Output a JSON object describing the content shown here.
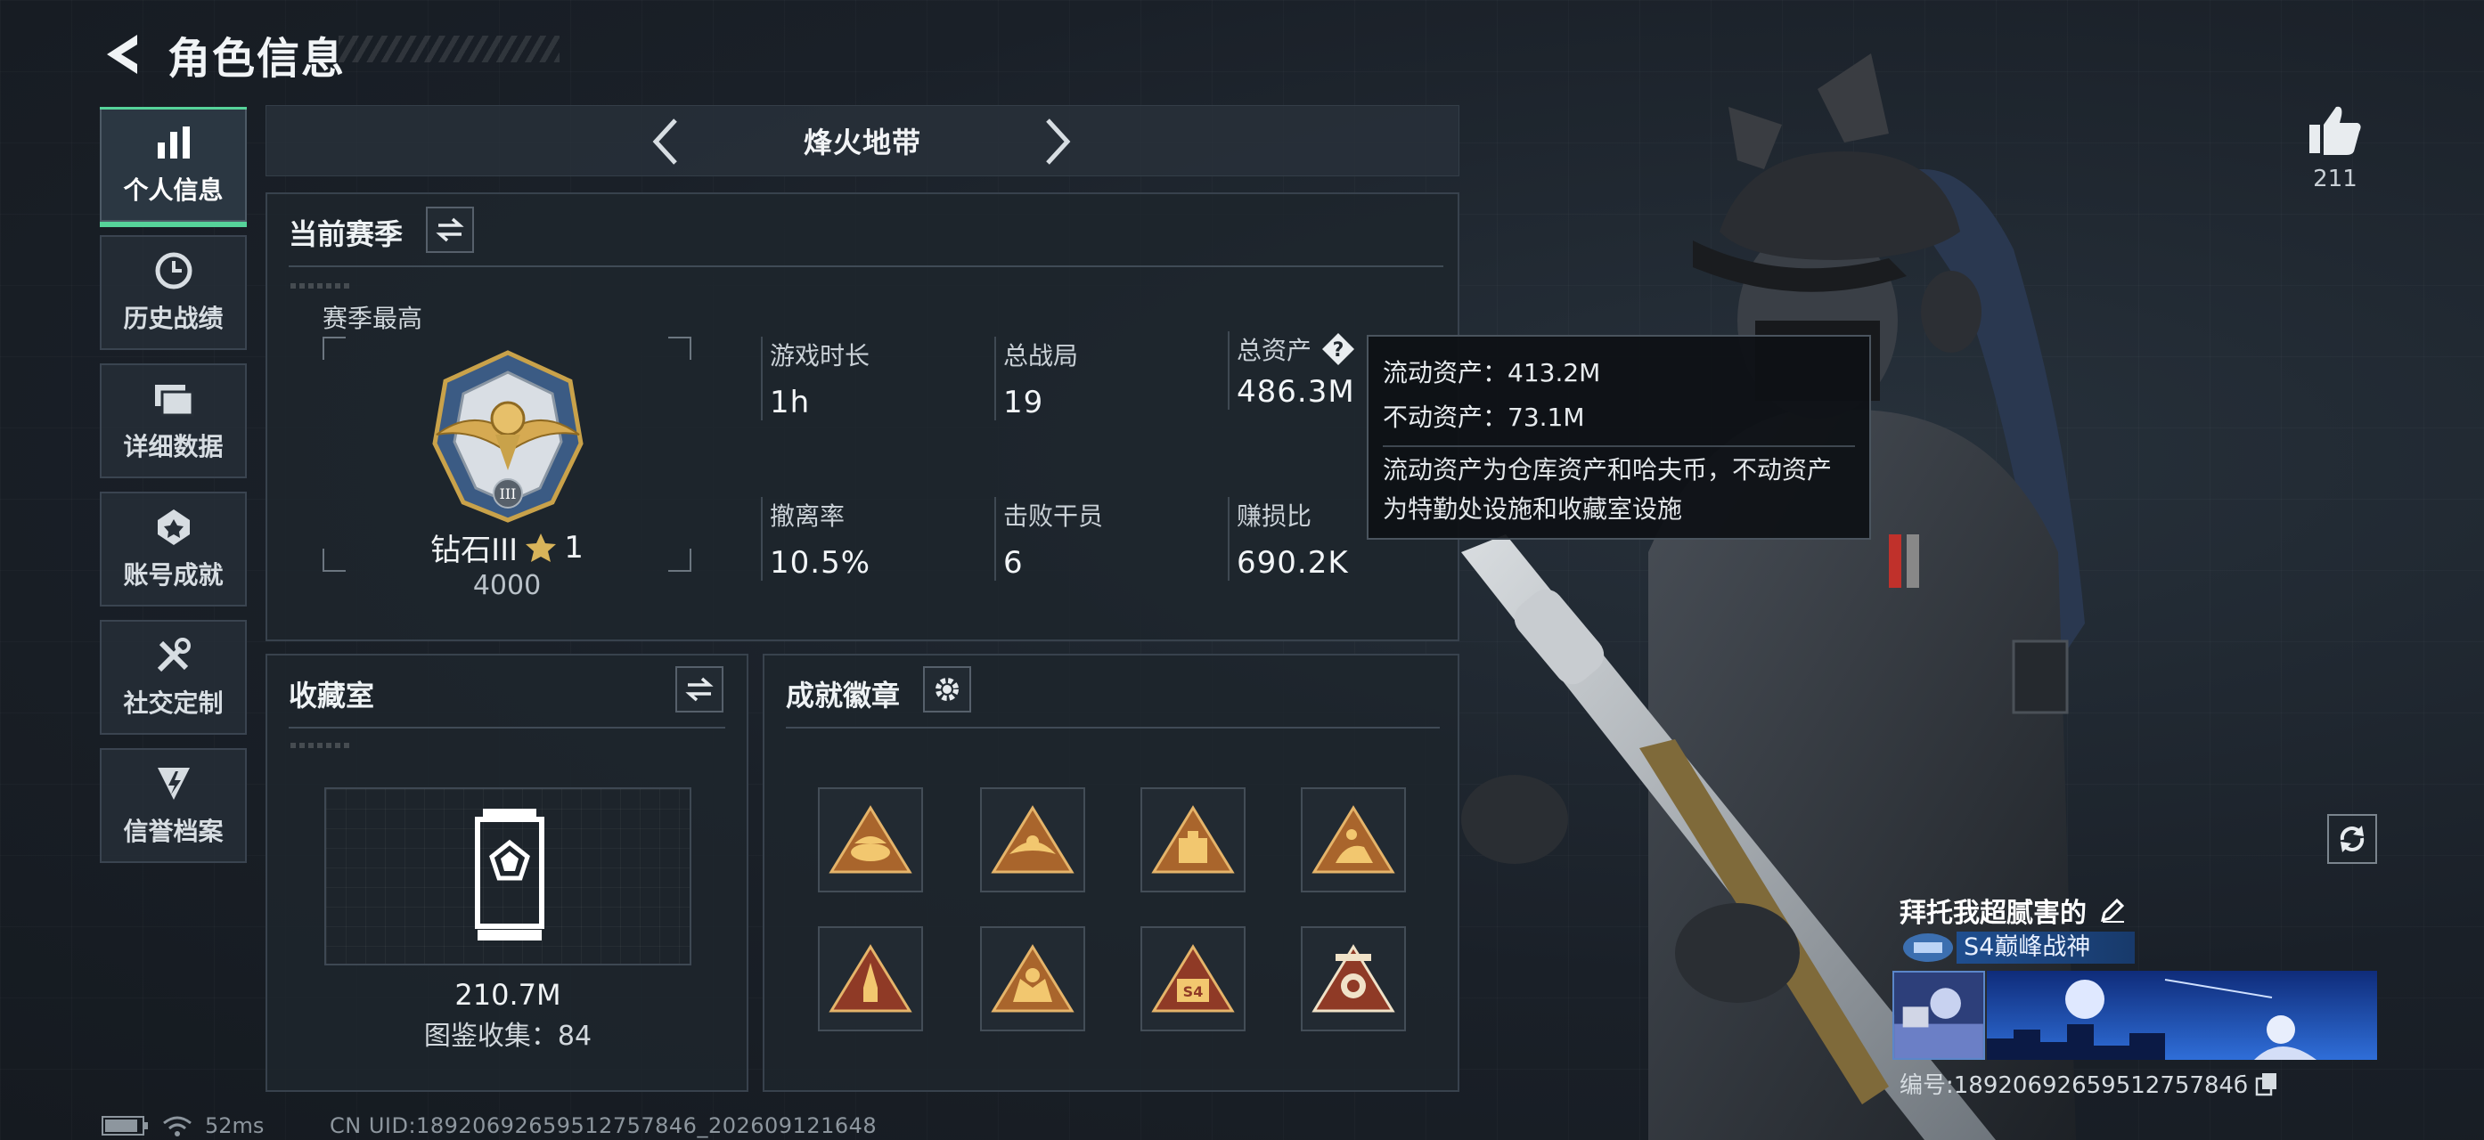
{
  "header": {
    "title": "角色信息"
  },
  "sidebar": {
    "items": [
      {
        "label": "个人信息",
        "icon": "bar-chart-icon",
        "active": true
      },
      {
        "label": "历史战绩",
        "icon": "clock-icon"
      },
      {
        "label": "详细数据",
        "icon": "folder-icon"
      },
      {
        "label": "账号成就",
        "icon": "medal-icon"
      },
      {
        "label": "社交定制",
        "icon": "tools-icon"
      },
      {
        "label": "信誉档案",
        "icon": "shield-icon"
      }
    ]
  },
  "mode": {
    "name": "烽火地带"
  },
  "season": {
    "title": "当前赛季",
    "best_label": "赛季最高",
    "rank_name": "钻石III",
    "rank_stars": "1",
    "rank_points": "4000",
    "stats": [
      {
        "label": "游戏时长",
        "value": "1h"
      },
      {
        "label": "总战局",
        "value": "19"
      },
      {
        "label": "总资产",
        "value": "486.3M"
      },
      {
        "label": "撤离率",
        "value": "10.5%"
      },
      {
        "label": "击败干员",
        "value": "6"
      },
      {
        "label": "赚损比",
        "value": "690.2K"
      }
    ]
  },
  "tooltip": {
    "liquid": "流动资产：413.2M",
    "fixed": "不动资产：73.1M",
    "desc_line1": "流动资产为仓库资产和哈夫币，不动资产",
    "desc_line2": "为特勤处设施和收藏室设施"
  },
  "collection": {
    "title": "收藏室",
    "value": "210.7M",
    "count": "图鉴收集：84"
  },
  "badges": {
    "title": "成就徽章",
    "items": [
      "badge-bowl",
      "badge-eagle",
      "badge-crate",
      "badge-rider",
      "badge-rocket",
      "badge-beast",
      "badge-s4",
      "badge-shield"
    ]
  },
  "profile": {
    "likes": "211",
    "player_name": "拜托我超腻害的",
    "title_plate": "S4巅峰战神",
    "player_id": "编号:1892069265951275784б"
  },
  "status": {
    "ping": "52ms",
    "uid": "CN UID:18920692659512757846_202609121648"
  },
  "colors": {
    "accent": "#56d39a",
    "gold": "#c9a24a"
  }
}
